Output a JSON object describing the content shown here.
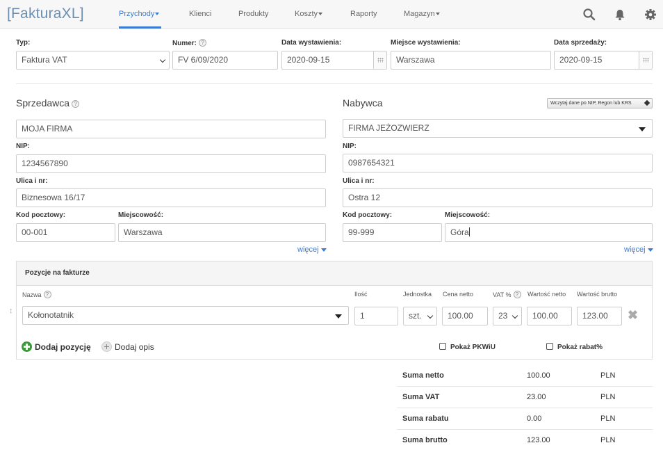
{
  "app": {
    "logo": "[FakturaXL]"
  },
  "nav": {
    "items": [
      "Przychody",
      "Klienci",
      "Produkty",
      "Koszty",
      "Raporty",
      "Magazyn"
    ],
    "active_index": 0
  },
  "header_fields": {
    "typ_label": "Typ:",
    "typ_value": "Faktura VAT",
    "numer_label": "Numer:",
    "numer_value": "FV 6/09/2020",
    "data_wyst_label": "Data wystawienia:",
    "data_wyst_value": "2020-09-15",
    "miejsce_label": "Miejsce wystawienia:",
    "miejsce_value": "Warszawa",
    "data_sprz_label": "Data sprzedaży:",
    "data_sprz_value": "2020-09-15"
  },
  "seller": {
    "title": "Sprzedawca",
    "name": "MOJA FIRMA",
    "nip_label": "NIP:",
    "nip": "1234567890",
    "street_label": "Ulica i nr:",
    "street": "Biznesowa 16/17",
    "postal_label": "Kod pocztowy:",
    "postal": "00-001",
    "city_label": "Miejscowość:",
    "city": "Warszawa",
    "more": "więcej"
  },
  "buyer": {
    "title": "Nabywca",
    "lookup_button": "Wczytaj dane po NIP, Regon lub KRS",
    "name": "FIRMA JEŻOZWIERZ",
    "nip_label": "NIP:",
    "nip": "0987654321",
    "street_label": "Ulica i nr:",
    "street": "Ostra 12",
    "postal_label": "Kod pocztowy:",
    "postal": "99-999",
    "city_label": "Miejscowość:",
    "city": "Góra",
    "more": "więcej"
  },
  "positions": {
    "title": "Pozycje na fakturze",
    "columns": {
      "name": "Nazwa",
      "qty": "Ilość",
      "unit": "Jednostka",
      "net_price": "Cena netto",
      "vat": "VAT %",
      "net_value": "Wartość netto",
      "gross_value": "Wartość brutto"
    },
    "rows": [
      {
        "name": "Kołonotatnik",
        "qty": "1",
        "unit": "szt.",
        "net_price": "100.00",
        "vat": "23",
        "net_value": "100.00",
        "gross_value": "123.00"
      }
    ],
    "add_position": "Dodaj pozycję",
    "add_description": "Dodaj opis",
    "show_pkwiu": "Pokaż PKWiU",
    "show_discount": "Pokaż rabat%"
  },
  "summary": [
    {
      "label": "Suma netto",
      "value": "100.00",
      "currency": "PLN"
    },
    {
      "label": "Suma VAT",
      "value": "23.00",
      "currency": "PLN"
    },
    {
      "label": "Suma rabatu",
      "value": "0.00",
      "currency": "PLN"
    },
    {
      "label": "Suma brutto",
      "value": "123.00",
      "currency": "PLN"
    }
  ],
  "colors": {
    "accent": "#3a7bd5",
    "logo": "#6b8fb3",
    "add_green": "#3a9a3a"
  },
  "icons": [
    "search-icon",
    "bell-icon",
    "gear-icon",
    "calendar-icon",
    "help-icon",
    "remove-icon",
    "drag-handle-icon"
  ]
}
